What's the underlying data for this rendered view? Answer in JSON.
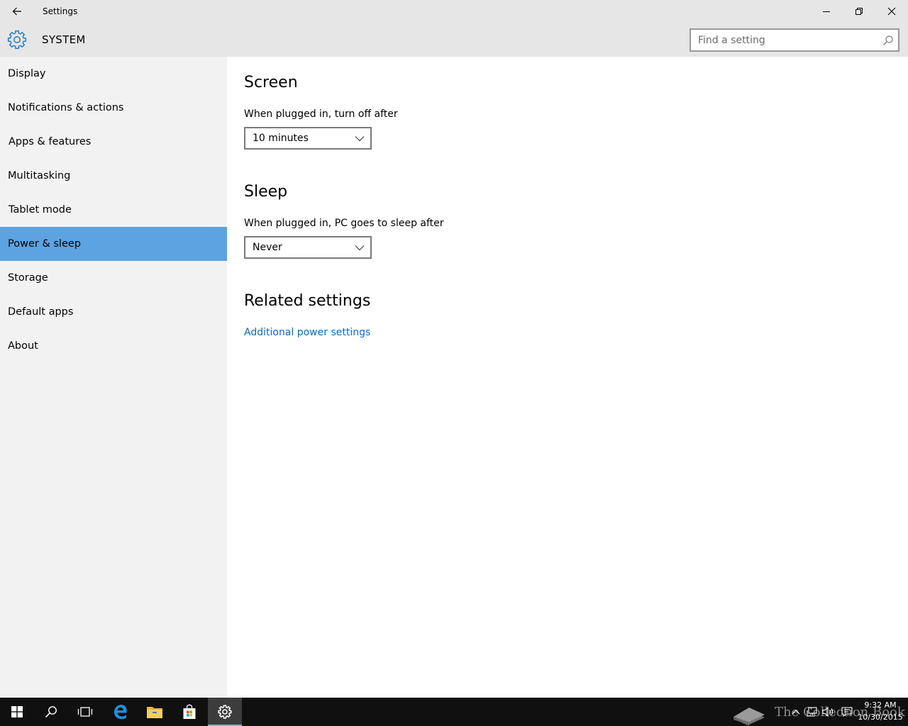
{
  "window": {
    "title": "Settings"
  },
  "header": {
    "section_title": "SYSTEM",
    "search_placeholder": "Find a setting"
  },
  "sidebar": {
    "items": [
      {
        "label": "Display",
        "selected": false
      },
      {
        "label": "Notifications & actions",
        "selected": false
      },
      {
        "label": "Apps & features",
        "selected": false
      },
      {
        "label": "Multitasking",
        "selected": false
      },
      {
        "label": "Tablet mode",
        "selected": false
      },
      {
        "label": "Power & sleep",
        "selected": true
      },
      {
        "label": "Storage",
        "selected": false
      },
      {
        "label": "Default apps",
        "selected": false
      },
      {
        "label": "About",
        "selected": false
      }
    ]
  },
  "main": {
    "screen": {
      "heading": "Screen",
      "label": "When plugged in, turn off after",
      "value": "10 minutes"
    },
    "sleep": {
      "heading": "Sleep",
      "label": "When plugged in, PC goes to sleep after",
      "value": "Never"
    },
    "related": {
      "heading": "Related settings",
      "link": "Additional power settings"
    }
  },
  "taskbar": {
    "watermark": "The Collection Book",
    "time": "9:32 AM",
    "date": "10/30/2015"
  },
  "colors": {
    "accent": "#5ca3e0",
    "link": "#0a6cbf",
    "gear": "#2b7fd1",
    "chrome": "#e6e6e6",
    "sidebar": "#f2f2f2",
    "taskbar": "#101010"
  },
  "icons": {
    "back": "arrow-left-icon",
    "app": "gear-icon",
    "search": "magnifier-icon",
    "minimize": "minimize-icon",
    "restore": "restore-icon",
    "close": "close-icon",
    "dropdown": "chevron-down-icon"
  }
}
